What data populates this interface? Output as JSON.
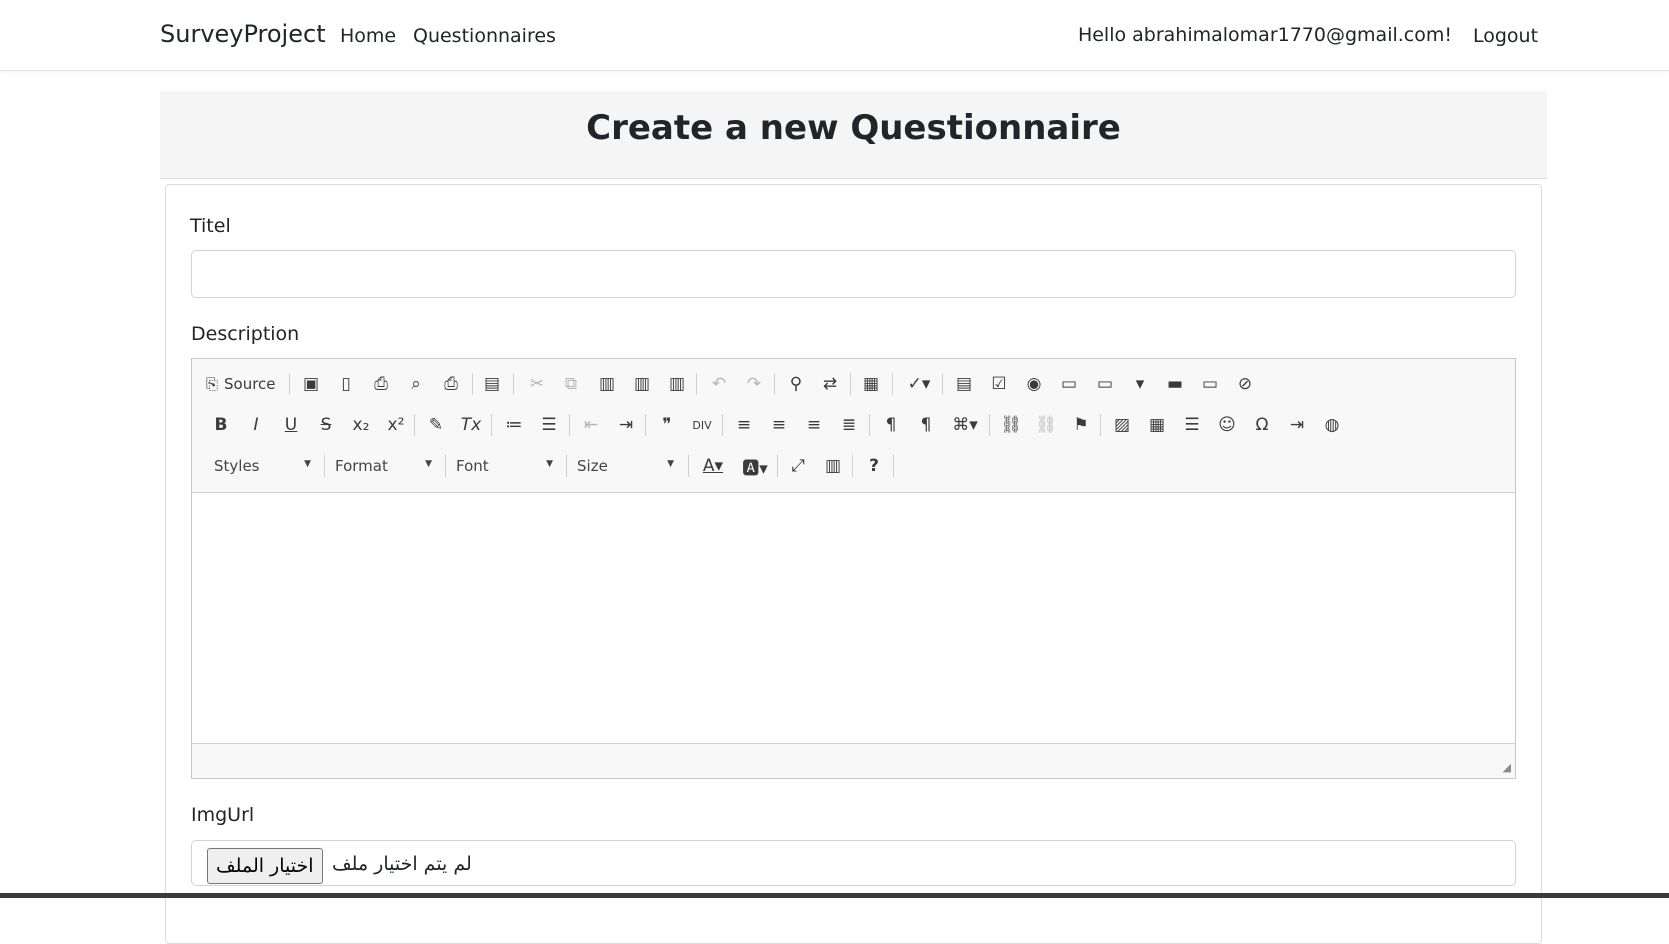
{
  "navbar": {
    "brand": "SurveyProject",
    "links": [
      "Home",
      "Questionnaires"
    ],
    "greeting": "Hello abrahimalomar1770@gmail.com!",
    "logout": "Logout"
  },
  "header": {
    "title": "Create a new Questionnaire"
  },
  "form": {
    "titel_label": "Titel",
    "titel_value": "",
    "description_label": "Description",
    "imgurl_label": "ImgUrl",
    "file_button": "اختيار الملف",
    "file_status": "لم يتم اختيار ملف"
  },
  "editor": {
    "source_label": "Source",
    "combos": {
      "styles": "Styles",
      "format": "Format",
      "font": "Font",
      "size": "Size"
    },
    "icons": {
      "row1": [
        "source",
        "save",
        "new-page",
        "export-pdf",
        "preview",
        "print",
        "templates",
        "cut",
        "copy",
        "paste",
        "paste-text",
        "paste-word",
        "undo",
        "redo",
        "find",
        "replace",
        "select-all",
        "spellcheck",
        "form",
        "checkbox",
        "radio",
        "text-field",
        "textarea",
        "select",
        "button",
        "image-button",
        "hidden-field"
      ],
      "row2": [
        "bold",
        "italic",
        "underline",
        "strikethrough",
        "subscript",
        "superscript",
        "copy-formatting",
        "remove-format",
        "numbered-list",
        "bulleted-list",
        "decrease-indent",
        "increase-indent",
        "blockquote",
        "create-div",
        "align-left",
        "align-center",
        "align-right",
        "justify",
        "ltr",
        "rtl",
        "language",
        "link",
        "unlink",
        "anchor",
        "image",
        "table",
        "horizontal-line",
        "smiley",
        "special-char",
        "page-break",
        "iframe"
      ],
      "row3": [
        "text-color",
        "background-color",
        "maximize",
        "show-blocks",
        "about"
      ]
    }
  }
}
